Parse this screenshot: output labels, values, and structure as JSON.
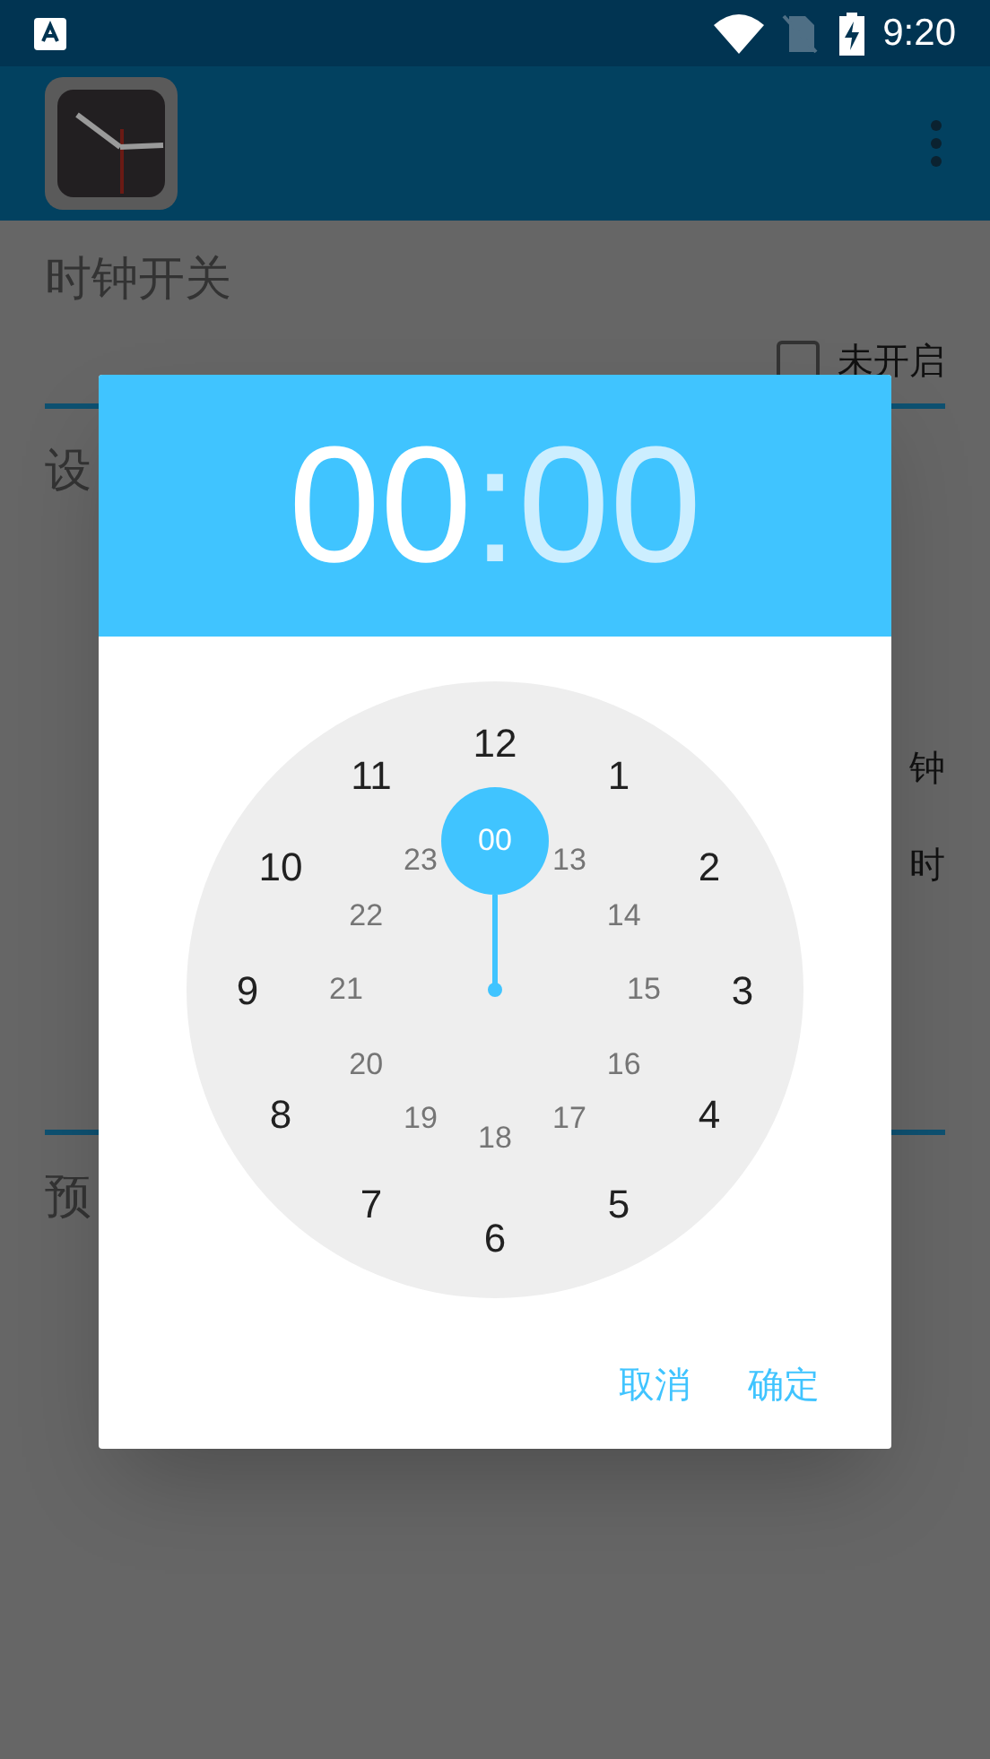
{
  "status_bar": {
    "time": "9:20"
  },
  "background": {
    "section_1_title": "时钟开关",
    "switch": {
      "label": "未开启",
      "checked": false
    },
    "section_2_title": "设",
    "row_1_text": "钟",
    "row_2_text": "时",
    "section_3_title": "预"
  },
  "dialog": {
    "hours": {
      "text": "00",
      "selected": true
    },
    "separator": ":",
    "minutes": {
      "text": "00",
      "selected": false
    },
    "outer_numbers": [
      {
        "label": "12",
        "selected": false
      },
      {
        "label": "1",
        "selected": false
      },
      {
        "label": "2",
        "selected": false
      },
      {
        "label": "3",
        "selected": false
      },
      {
        "label": "4",
        "selected": false
      },
      {
        "label": "5",
        "selected": false
      },
      {
        "label": "6",
        "selected": false
      },
      {
        "label": "7",
        "selected": false
      },
      {
        "label": "8",
        "selected": false
      },
      {
        "label": "9",
        "selected": false
      },
      {
        "label": "10",
        "selected": false
      },
      {
        "label": "11",
        "selected": false
      }
    ],
    "inner_numbers": [
      {
        "label": "00",
        "selected": true
      },
      {
        "label": "13",
        "selected": false
      },
      {
        "label": "14",
        "selected": false
      },
      {
        "label": "15",
        "selected": false
      },
      {
        "label": "16",
        "selected": false
      },
      {
        "label": "17",
        "selected": false
      },
      {
        "label": "18",
        "selected": false
      },
      {
        "label": "19",
        "selected": false
      },
      {
        "label": "20",
        "selected": false
      },
      {
        "label": "21",
        "selected": false
      },
      {
        "label": "22",
        "selected": false
      },
      {
        "label": "23",
        "selected": false
      }
    ],
    "buttons": [
      "取消",
      "确定"
    ]
  }
}
